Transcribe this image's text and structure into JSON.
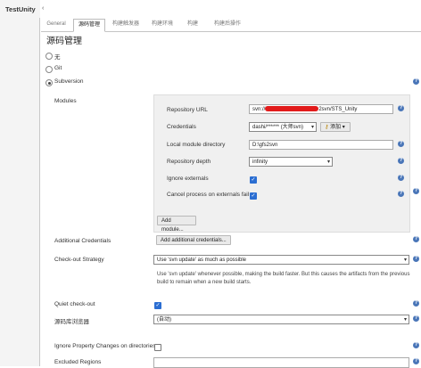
{
  "app": {
    "title": "TestUnity",
    "arrow": "‹"
  },
  "tabs": [
    {
      "label": "General"
    },
    {
      "label": "源码管理"
    },
    {
      "label": "构建触发器"
    },
    {
      "label": "构建环境"
    },
    {
      "label": "构建"
    },
    {
      "label": "构建后操作"
    }
  ],
  "section": {
    "title": "源码管理"
  },
  "scm_options": [
    {
      "label": "无",
      "selected": false
    },
    {
      "label": "Git",
      "selected": false
    },
    {
      "label": "Subversion",
      "selected": true
    }
  ],
  "modules": {
    "label": "Modules",
    "repo_url_label": "Repository URL",
    "repo_url_prefix": "svn://",
    "repo_url_value": "2svn/STS_Unity",
    "credentials_label": "Credentials",
    "credentials_value": "dashi/****** (大师svn)",
    "add_label": "添加",
    "local_dir_label": "Local module directory",
    "local_dir_value": "D:\\gfs2svn",
    "depth_label": "Repository depth",
    "depth_value": "infinity",
    "ignore_externals_label": "Ignore externals",
    "ignore_externals": true,
    "cancel_externals_label": "Cancel process on externals fail",
    "cancel_externals": true,
    "add_module_label": "Add module..."
  },
  "additional_credentials": {
    "label": "Additional Credentials",
    "button": "Add additional credentials..."
  },
  "checkout_strategy": {
    "label": "Check-out Strategy",
    "value": "Use 'svn update' as much as possible",
    "description": "Use 'svn update' whenever possible, making the build faster. But this causes the artifacts from the previous build to remain when a new build starts."
  },
  "quiet_checkout": {
    "label": "Quiet check-out",
    "checked": true
  },
  "repo_browser": {
    "label": "源码库浏览器",
    "value": "(自动)"
  },
  "ignore_property": {
    "label": "Ignore Property Changes on directories",
    "checked": false
  },
  "excluded_regions": {
    "label": "Excluded Regions"
  },
  "help_glyph": "?",
  "colors": {
    "accent": "#4a76b8",
    "checkbox": "#2b6ed2",
    "redaction": "#e21b1b"
  }
}
